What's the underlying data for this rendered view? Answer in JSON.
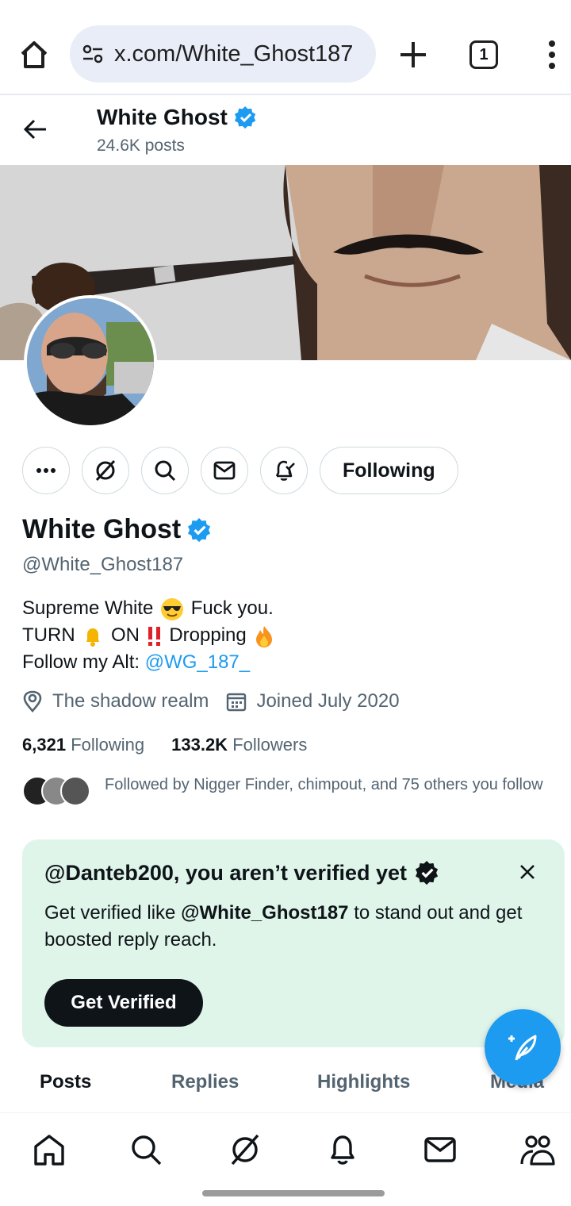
{
  "browser": {
    "url": "x.com/White_Ghost187",
    "tab_count": "1",
    "icons": [
      "home-icon",
      "site-settings-icon",
      "new-tab-plus-icon",
      "tab-switcher-icon",
      "more-vert-icon"
    ]
  },
  "header": {
    "name": "White Ghost",
    "posts_count": "24.6K posts"
  },
  "profile": {
    "display_name": "White Ghost",
    "handle": "@White_Ghost187",
    "bio_line1_a": "Supreme White",
    "bio_line1_b": "Fuck you.",
    "bio_line2_a": "TURN",
    "bio_line2_b": "ON",
    "bio_line2_c": "Dropping",
    "bio_line3_a": "Follow my Alt:",
    "bio_line3_link": "@WG_187_",
    "location": "The shadow realm",
    "joined": "Joined July 2020",
    "following_count": "6,321",
    "following_label": "Following",
    "followers_count": "133.2K",
    "followers_label": "Followers",
    "followed_by": "Followed by Nigger Finder, chimpout, and 75 others you follow"
  },
  "actions": {
    "following_button": "Following",
    "icons": [
      "more-icon",
      "grok-icon",
      "search-icon",
      "message-icon",
      "notification-bell-icon"
    ]
  },
  "verify_card": {
    "title": "@Danteb200, you aren’t verified yet",
    "body_prefix": "Get verified like",
    "body_handle": "@White_Ghost187",
    "body_suffix": "to stand out and get boosted reply reach.",
    "button": "Get Verified"
  },
  "tabs": [
    "Posts",
    "Replies",
    "Highlights",
    "Media"
  ],
  "bottom_nav": [
    "home-icon",
    "search-icon",
    "grok-icon",
    "notifications-icon",
    "messages-icon",
    "communities-icon"
  ],
  "colors": {
    "accent": "#1d9bf0",
    "card_bg": "#dff5ea",
    "text": "#0f1419",
    "muted": "#536471"
  }
}
